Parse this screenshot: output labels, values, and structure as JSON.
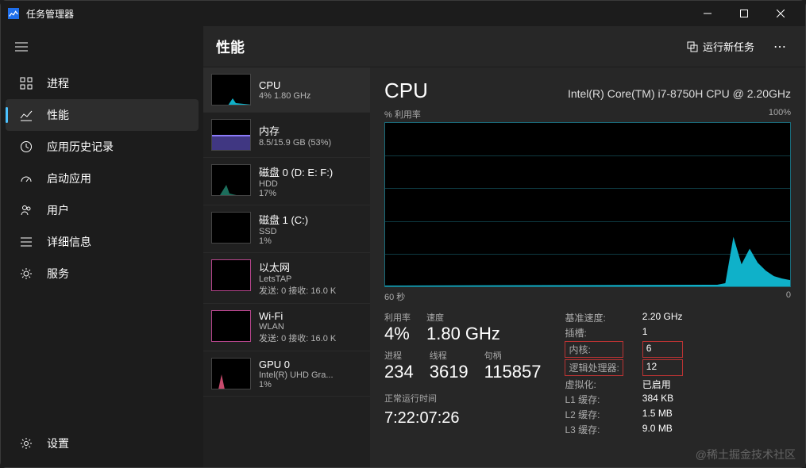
{
  "window": {
    "title": "任务管理器"
  },
  "header": {
    "title": "性能",
    "run_task_label": "运行新任务"
  },
  "sidebar": {
    "items": [
      {
        "label": "进程"
      },
      {
        "label": "性能"
      },
      {
        "label": "应用历史记录"
      },
      {
        "label": "启动应用"
      },
      {
        "label": "用户"
      },
      {
        "label": "详细信息"
      },
      {
        "label": "服务"
      }
    ],
    "settings_label": "设置"
  },
  "resources": [
    {
      "title": "CPU",
      "sub1": "4% 1.80 GHz",
      "sub2": ""
    },
    {
      "title": "内存",
      "sub1": "8.5/15.9 GB (53%)",
      "sub2": ""
    },
    {
      "title": "磁盘 0 (D: E: F:)",
      "sub1": "HDD",
      "sub2": "17%"
    },
    {
      "title": "磁盘 1 (C:)",
      "sub1": "SSD",
      "sub2": "1%"
    },
    {
      "title": "以太网",
      "sub1": "LetsTAP",
      "sub2": "发送: 0 接收: 16.0 K"
    },
    {
      "title": "Wi-Fi",
      "sub1": "WLAN",
      "sub2": "发送: 0 接收: 16.0 K"
    },
    {
      "title": "GPU 0",
      "sub1": "Intel(R) UHD Gra...",
      "sub2": "1%"
    }
  ],
  "detail": {
    "title": "CPU",
    "model": "Intel(R) Core(TM) i7-8750H CPU @ 2.20GHz",
    "chart_top_left": "% 利用率",
    "chart_top_right": "100%",
    "chart_bottom_left": "60 秒",
    "chart_bottom_right": "0",
    "labels": {
      "utilization": "利用率",
      "speed": "速度",
      "processes": "进程",
      "threads": "线程",
      "handles": "句柄",
      "uptime": "正常运行时间",
      "base_speed": "基准速度:",
      "sockets": "插槽:",
      "cores": "内核:",
      "logical": "逻辑处理器:",
      "virtualization": "虚拟化:",
      "l1": "L1 缓存:",
      "l2": "L2 缓存:",
      "l3": "L3 缓存:"
    },
    "values": {
      "utilization": "4%",
      "speed": "1.80 GHz",
      "processes": "234",
      "threads": "3619",
      "handles": "115857",
      "uptime": "7:22:07:26",
      "base_speed": "2.20 GHz",
      "sockets": "1",
      "cores": "6",
      "logical": "12",
      "virtualization": "已启用",
      "l1": "384 KB",
      "l2": "1.5 MB",
      "l3": "9.0 MB"
    }
  },
  "watermark": "@稀土掘金技术社区",
  "chart_data": {
    "type": "area",
    "title": "CPU % 利用率",
    "ylabel": "% 利用率",
    "ylim": [
      0,
      100
    ],
    "xlabel": "秒",
    "xlim": [
      60,
      0
    ],
    "values": [
      2,
      2,
      2,
      2,
      2,
      2,
      2,
      2,
      2,
      2,
      2,
      2,
      2,
      2,
      2,
      2,
      2,
      2,
      2,
      2,
      2,
      2,
      2,
      2,
      2,
      2,
      2,
      2,
      2,
      2,
      2,
      2,
      2,
      2,
      2,
      2,
      2,
      2,
      2,
      2,
      2,
      2,
      2,
      2,
      2,
      2,
      2,
      2,
      2,
      3,
      4,
      30,
      15,
      22,
      14,
      10,
      8,
      6,
      5,
      4
    ]
  }
}
